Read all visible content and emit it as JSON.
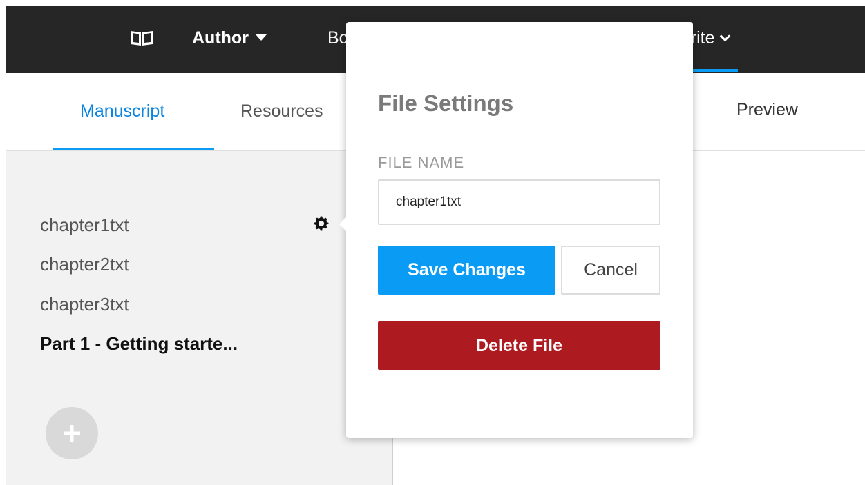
{
  "header": {
    "brand_icon": "open-book-icon",
    "author_label": "Author",
    "books_label": "Bo",
    "write_label": "Vrite",
    "colors": {
      "bar": "#262626",
      "accent": "#0a9cf5"
    }
  },
  "sidebar": {
    "tabs": [
      {
        "label": "Manuscript",
        "active": true
      },
      {
        "label": "Resources",
        "active": false
      }
    ],
    "files": [
      {
        "label": "chapter1txt"
      },
      {
        "label": "chapter2txt"
      },
      {
        "label": "chapter3txt"
      },
      {
        "label": "Part 1 - Getting starte...",
        "bold": true
      }
    ],
    "settings_icon": "gear-icon",
    "add_icon": "plus-icon"
  },
  "editor": {
    "preview_label": "Preview"
  },
  "popover": {
    "title": "File Settings",
    "field_label": "FILE NAME",
    "file_name_value": "chapter1txt",
    "save_label": "Save Changes",
    "cancel_label": "Cancel",
    "delete_label": "Delete File",
    "colors": {
      "save": "#0a9cf5",
      "delete": "#ad1a1f"
    }
  }
}
